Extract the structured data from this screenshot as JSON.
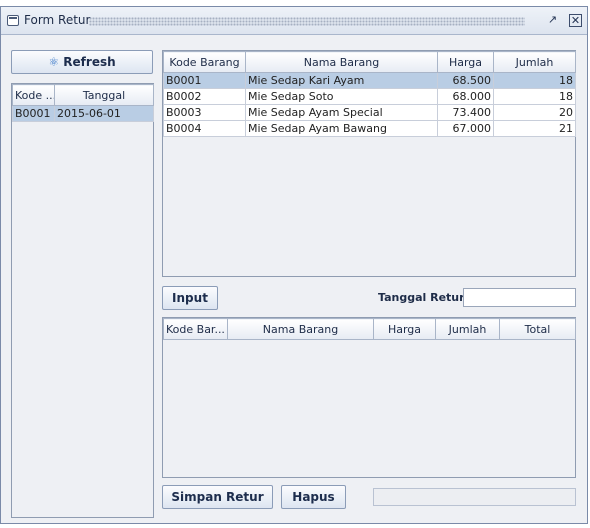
{
  "window": {
    "title": "Form Retur"
  },
  "left": {
    "refresh_label": "Refresh",
    "columns": [
      "Kode ...",
      "Tanggal"
    ],
    "rows": [
      [
        "B0001",
        "2015-06-01"
      ]
    ]
  },
  "top_table": {
    "columns": [
      "Kode Barang",
      "Nama Barang",
      "Harga",
      "Jumlah"
    ],
    "rows": [
      [
        "B0001",
        "Mie Sedap Kari Ayam",
        "68.500",
        "18"
      ],
      [
        "B0002",
        "Mie Sedap Soto",
        "68.000",
        "18"
      ],
      [
        "B0003",
        "Mie Sedap Ayam Special",
        "73.400",
        "20"
      ],
      [
        "B0004",
        "Mie Sedap Ayam Bawang",
        "67.000",
        "21"
      ]
    ],
    "selected_row": 0
  },
  "input_label": "Input",
  "tanggal_retur_label": "Tanggal Retur",
  "tanggal_retur_value": "",
  "bottom_table": {
    "columns": [
      "Kode Bar...",
      "Nama Barang",
      "Harga",
      "Jumlah",
      "Total"
    ]
  },
  "simpan_label": "Simpan Retur",
  "hapus_label": "Hapus",
  "status_value": ""
}
